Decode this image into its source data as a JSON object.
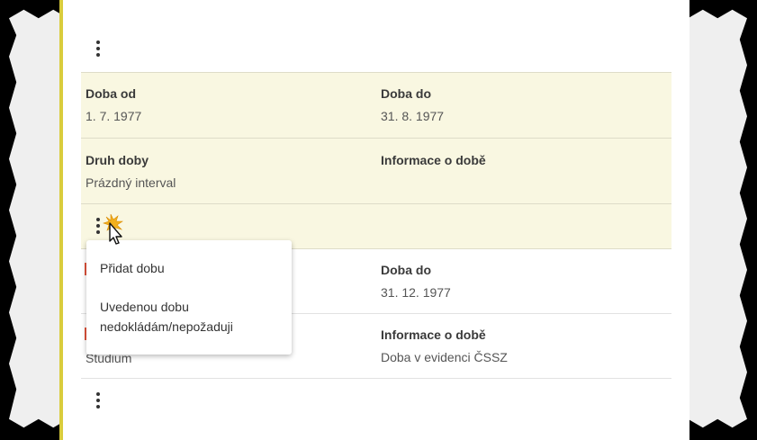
{
  "top_menu_icon": "more-vertical-icon",
  "record1": {
    "doba_od": {
      "label": "Doba od",
      "value": "1. 7. 1977"
    },
    "doba_do": {
      "label": "Doba do",
      "value": "31. 8. 1977"
    },
    "druh_doby": {
      "label": "Druh doby",
      "value": "Prázdný interval"
    },
    "informace": {
      "label": "Informace o době",
      "value": ""
    }
  },
  "record2": {
    "doba_do": {
      "label": "Doba do",
      "value": "31. 12. 1977"
    },
    "druh_doby_value": "Studium",
    "informace": {
      "label": "Informace o době",
      "value": "Doba v evidenci ČSSZ"
    }
  },
  "context_menu": {
    "add": "Přidat dobu",
    "decline_line1": "Uvedenou dobu",
    "decline_line2": "nedokládám/nepožaduji"
  },
  "colors": {
    "accent": "#d9cc3c",
    "highlight": "#f9f7e1",
    "marker": "#e0533c"
  }
}
